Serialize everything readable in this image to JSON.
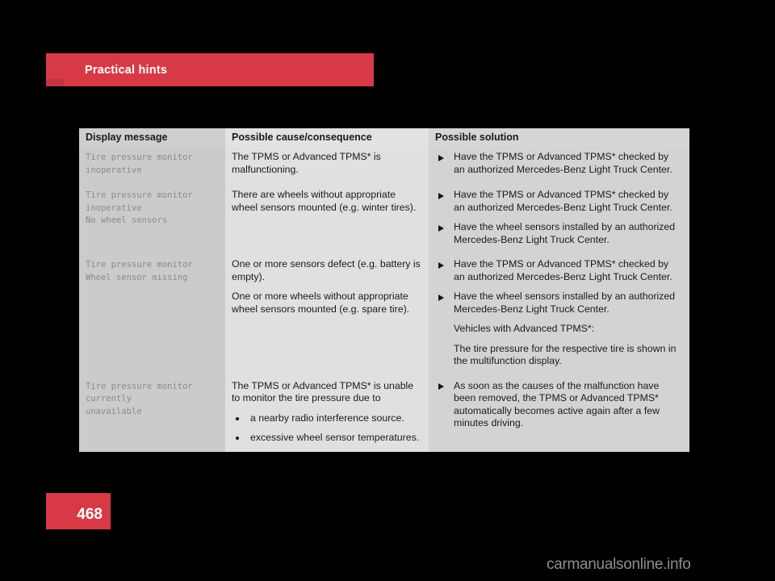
{
  "section": {
    "title": "Practical hints"
  },
  "page": {
    "number": "468",
    "watermark": "carmanualsonline.info"
  },
  "colors": {
    "accent_red": "#d83a45",
    "accent_red_tab": "#c23440",
    "page_background": "#000000",
    "column1_background": "#cbcbcb",
    "column2_background": "#e0e0e0",
    "column3_background": "#d3d3d3",
    "header_row_background": "#cfcfcf",
    "row_divider": "#f2f2f2",
    "message_text": "#8a8a8a",
    "body_text": "#1a1a1a"
  },
  "table": {
    "headers": [
      "Display message",
      "Possible cause/consequence",
      "Possible solution"
    ],
    "rows": [
      {
        "display_message": [
          "Tire pressure monitor",
          "inoperative"
        ],
        "cause": [
          "The TPMS or Advanced TPMS* is malfunctioning."
        ],
        "solution": [
          {
            "bullet": "triangle",
            "text": "Have the TPMS or Advanced TPMS* checked by an authorized Mercedes-Benz Light Truck Center."
          }
        ]
      },
      {
        "display_message": [
          "Tire pressure monitor",
          "inoperative",
          "No wheel sensors"
        ],
        "cause": [
          "There are wheels without appropriate wheel sensors mounted (e.g. winter tires)."
        ],
        "solution": [
          {
            "bullet": "triangle",
            "text": "Have the TPMS or Advanced TPMS* checked by an authorized Mercedes-Benz Light Truck Center."
          },
          {
            "bullet": "triangle",
            "text": "Have the wheel sensors installed by an authorized Mercedes-Benz Light Truck Center."
          }
        ]
      },
      {
        "display_message": [
          "Tire pressure monitor",
          "Wheel sensor missing"
        ],
        "cause": [
          "One or more sensors defect (e.g. battery is empty).",
          "One or more wheels without appropriate wheel sensors mounted (e.g. spare tire)."
        ],
        "solution": [
          {
            "bullet": "triangle",
            "text": "Have the TPMS or Advanced TPMS* checked by an authorized Mercedes-Benz Light Truck Center."
          },
          {
            "bullet": "triangle",
            "text": "Have the wheel sensors installed by an authorized Mercedes-Benz Light Truck Center."
          },
          {
            "bullet": "none",
            "text": "Vehicles with Advanced TPMS*:"
          },
          {
            "bullet": "none",
            "text": "The tire pressure for the respective tire is shown in the multifunction display."
          }
        ]
      },
      {
        "display_message": [
          "Tire pressure monitor",
          "currently",
          "unavailable"
        ],
        "cause_intro": "The TPMS or Advanced TPMS* is unable to monitor the tire pressure due to",
        "cause_bullets": [
          "a nearby radio interference source.",
          "excessive wheel sensor temperatures."
        ],
        "solution": [
          {
            "bullet": "triangle",
            "text": "As soon as the causes of the malfunction have been removed, the TPMS or Advanced TPMS* automatically becomes active again after a few minutes driving."
          }
        ]
      }
    ]
  }
}
